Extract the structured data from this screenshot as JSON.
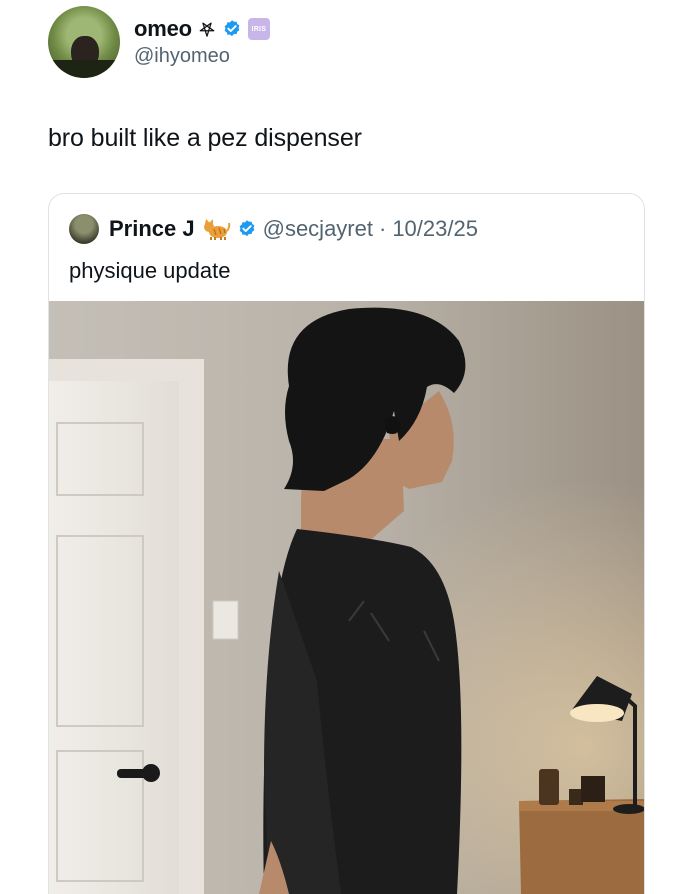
{
  "tweet": {
    "display_name": "omeo",
    "handle": "@ihyomeo",
    "iris_badge": "IRIS",
    "text": "bro built like a pez dispenser"
  },
  "quoted": {
    "display_name": "Prince J",
    "handle": "@secjayret",
    "separator": "·",
    "date": "10/23/25",
    "text": "physique update"
  },
  "colors": {
    "verified": "#1d9bf0",
    "muted": "#536471",
    "border": "#dfe3e6"
  },
  "icons": {
    "name_emblem": "pentagram-icon",
    "verified": "verified-badge-icon",
    "quoted_emoji": "cat-emoji-icon"
  }
}
